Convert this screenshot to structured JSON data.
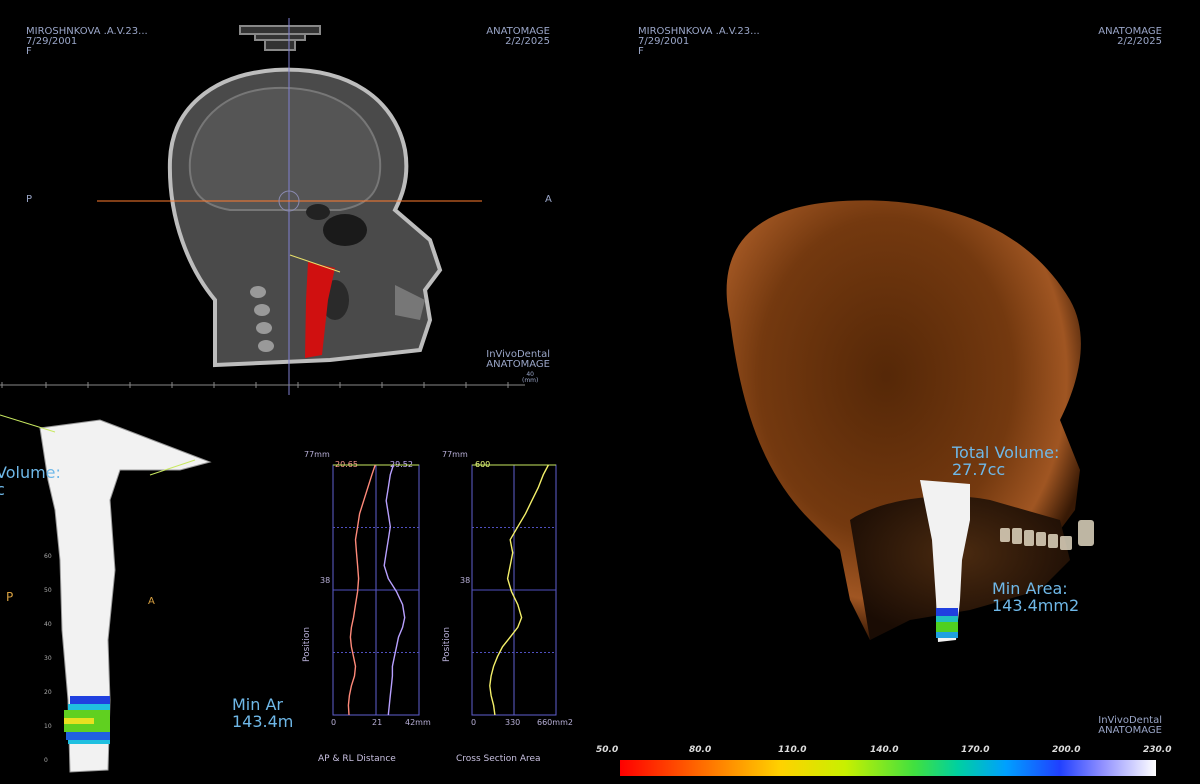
{
  "ceph_view": {
    "patient": "MIROSHNKOVA .A.V.23...",
    "dob": "7/29/2001",
    "sex": "F",
    "brand": "ANATOMAGE",
    "date": "2/2/2025",
    "orient_left": "P",
    "orient_right": "A",
    "footer_line1": "InVivoDental",
    "footer_line2": "ANATOMAGE",
    "scale_label": "40",
    "scale_unit": "(mm)"
  },
  "volume_view": {
    "patient": "MIROSHNKOVA .A.V.23...",
    "dob": "7/29/2001",
    "sex": "F",
    "brand": "ANATOMAGE",
    "date": "2/2/2025",
    "total_volume_label": "Total Volume:",
    "total_volume_value": "27.7cc",
    "min_area_label": "Min Area:",
    "min_area_value": "143.4mm2",
    "footer_line1": "InVivoDental",
    "footer_line2": "ANATOMAGE"
  },
  "airway_view": {
    "volume_label": "Volume:",
    "volume_value": "c",
    "orient_p": "P",
    "orient_a": "A",
    "min_area_label": "Min Ar",
    "min_area_value": "143.4m",
    "ticks": [
      "60",
      "50",
      "40",
      "30",
      "20",
      "10",
      "0"
    ]
  },
  "charts": {
    "distance": {
      "title": "AP & RL Distance",
      "y_top": "77mm",
      "y_mid": "38",
      "y_label": "Position",
      "x_ticks": [
        "0",
        "21",
        "42mm"
      ],
      "val_ap": "20.65",
      "val_rl": "29.52"
    },
    "area": {
      "title": "Cross Section Area",
      "y_top": "77mm",
      "y_mid": "38",
      "y_label": "Position",
      "x_ticks": [
        "0",
        "330",
        "660mm2"
      ],
      "val_area": "600"
    }
  },
  "chart_data": [
    {
      "type": "line",
      "title": "AP & RL Distance",
      "xlabel": "",
      "ylabel": "Position",
      "xlim": [
        0,
        42
      ],
      "ylim": [
        0,
        77
      ],
      "series": [
        {
          "name": "AP",
          "x": [
            20.6,
            19,
            17,
            15,
            13,
            12,
            11,
            11.5,
            12,
            12.5,
            12,
            11,
            10,
            9,
            8.5,
            9,
            10,
            11,
            10.5,
            9,
            8,
            7.5,
            7.8
          ],
          "y": [
            77,
            74,
            70,
            66,
            62,
            58,
            54,
            50,
            46,
            42,
            38,
            34,
            30,
            27,
            24,
            21,
            18,
            15,
            12,
            9,
            6,
            3,
            0
          ]
        },
        {
          "name": "RL",
          "x": [
            29.5,
            28,
            27,
            26,
            27,
            28,
            27,
            26,
            25,
            27,
            31,
            34,
            35,
            34,
            32,
            31,
            30,
            29,
            29,
            28.5,
            28,
            27.5,
            27
          ],
          "y": [
            77,
            74,
            70,
            66,
            62,
            58,
            54,
            50,
            46,
            42,
            38,
            34,
            30,
            27,
            24,
            21,
            18,
            15,
            12,
            9,
            6,
            3,
            0
          ]
        }
      ]
    },
    {
      "type": "line",
      "title": "Cross Section Area",
      "xlabel": "",
      "ylabel": "Position",
      "xlim": [
        0,
        660
      ],
      "ylim": [
        0,
        77
      ],
      "series": [
        {
          "name": "Area",
          "x": [
            600,
            560,
            520,
            470,
            420,
            360,
            300,
            320,
            300,
            280,
            310,
            360,
            390,
            360,
            300,
            240,
            200,
            170,
            150,
            140,
            150,
            170,
            180
          ],
          "y": [
            77,
            74,
            70,
            66,
            62,
            58,
            54,
            50,
            46,
            42,
            38,
            34,
            30,
            27,
            24,
            21,
            18,
            15,
            12,
            9,
            6,
            3,
            0
          ]
        }
      ]
    }
  ],
  "colorbar": {
    "ticks": [
      "50.0",
      "80.0",
      "110.0",
      "140.0",
      "170.0",
      "200.0",
      "230.0"
    ]
  }
}
